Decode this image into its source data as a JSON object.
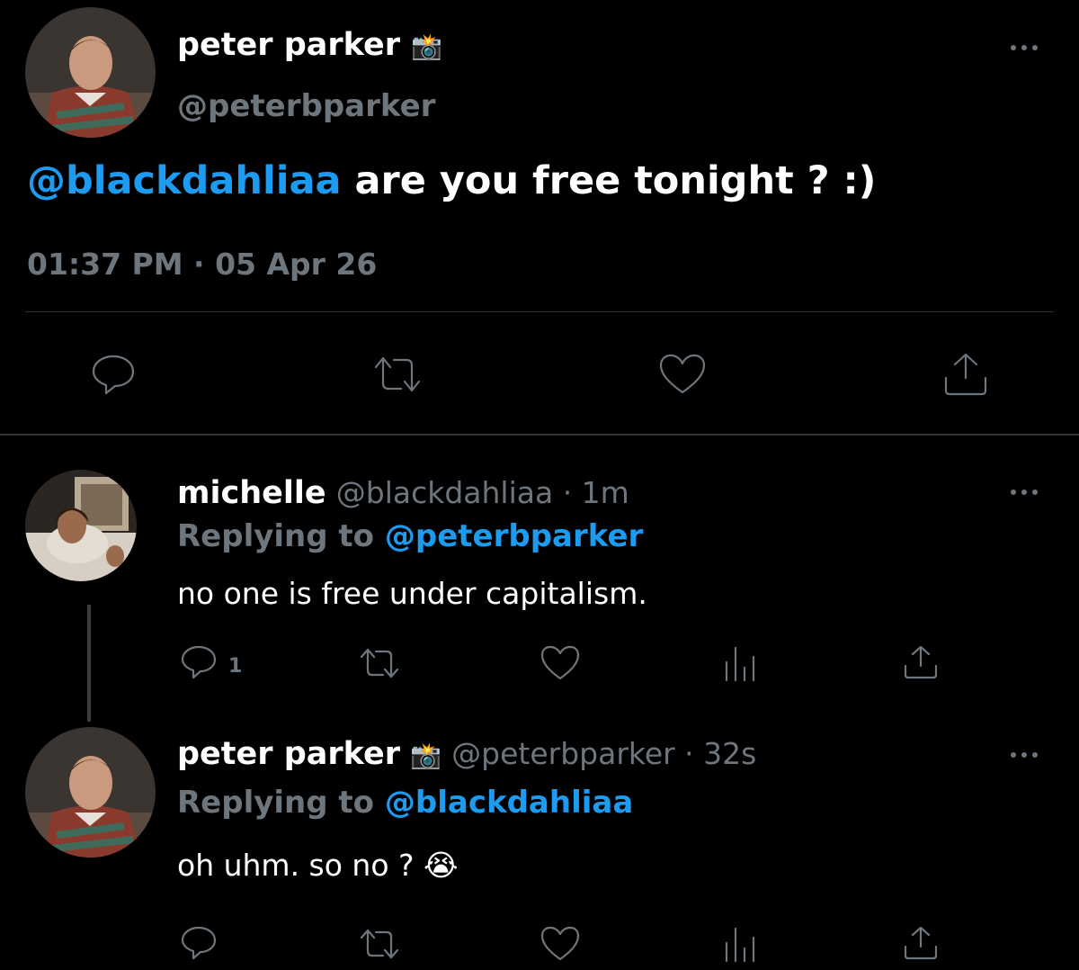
{
  "main_tweet": {
    "display_name": "peter parker",
    "name_emoji": "📸",
    "handle": "@peterbparker",
    "mention": "@blackdahliaa",
    "text": " are you free tonight ? :)",
    "timestamp": "01:37 PM · 05 Apr 26"
  },
  "replies": [
    {
      "display_name": "michelle",
      "meta": "@blackdahliaa · 1m",
      "replying_prefix": "Replying to ",
      "replying_handle": "@peterbparker",
      "text": "no one is free under capitalism.",
      "reply_count": "1"
    },
    {
      "display_name": "peter parker",
      "name_emoji": "📸",
      "meta": "@peterbparker · 32s",
      "replying_prefix": "Replying to ",
      "replying_handle": "@blackdahliaa",
      "text": "oh uhm. so no ? ",
      "text_emoji": "😭"
    }
  ],
  "colors": {
    "background": "#000000",
    "link": "#1d9bf0",
    "muted": "#6e767d",
    "text": "#e7e9ea"
  },
  "icons": [
    "reply-icon",
    "retweet-icon",
    "like-icon",
    "analytics-icon",
    "share-icon",
    "more-icon"
  ]
}
